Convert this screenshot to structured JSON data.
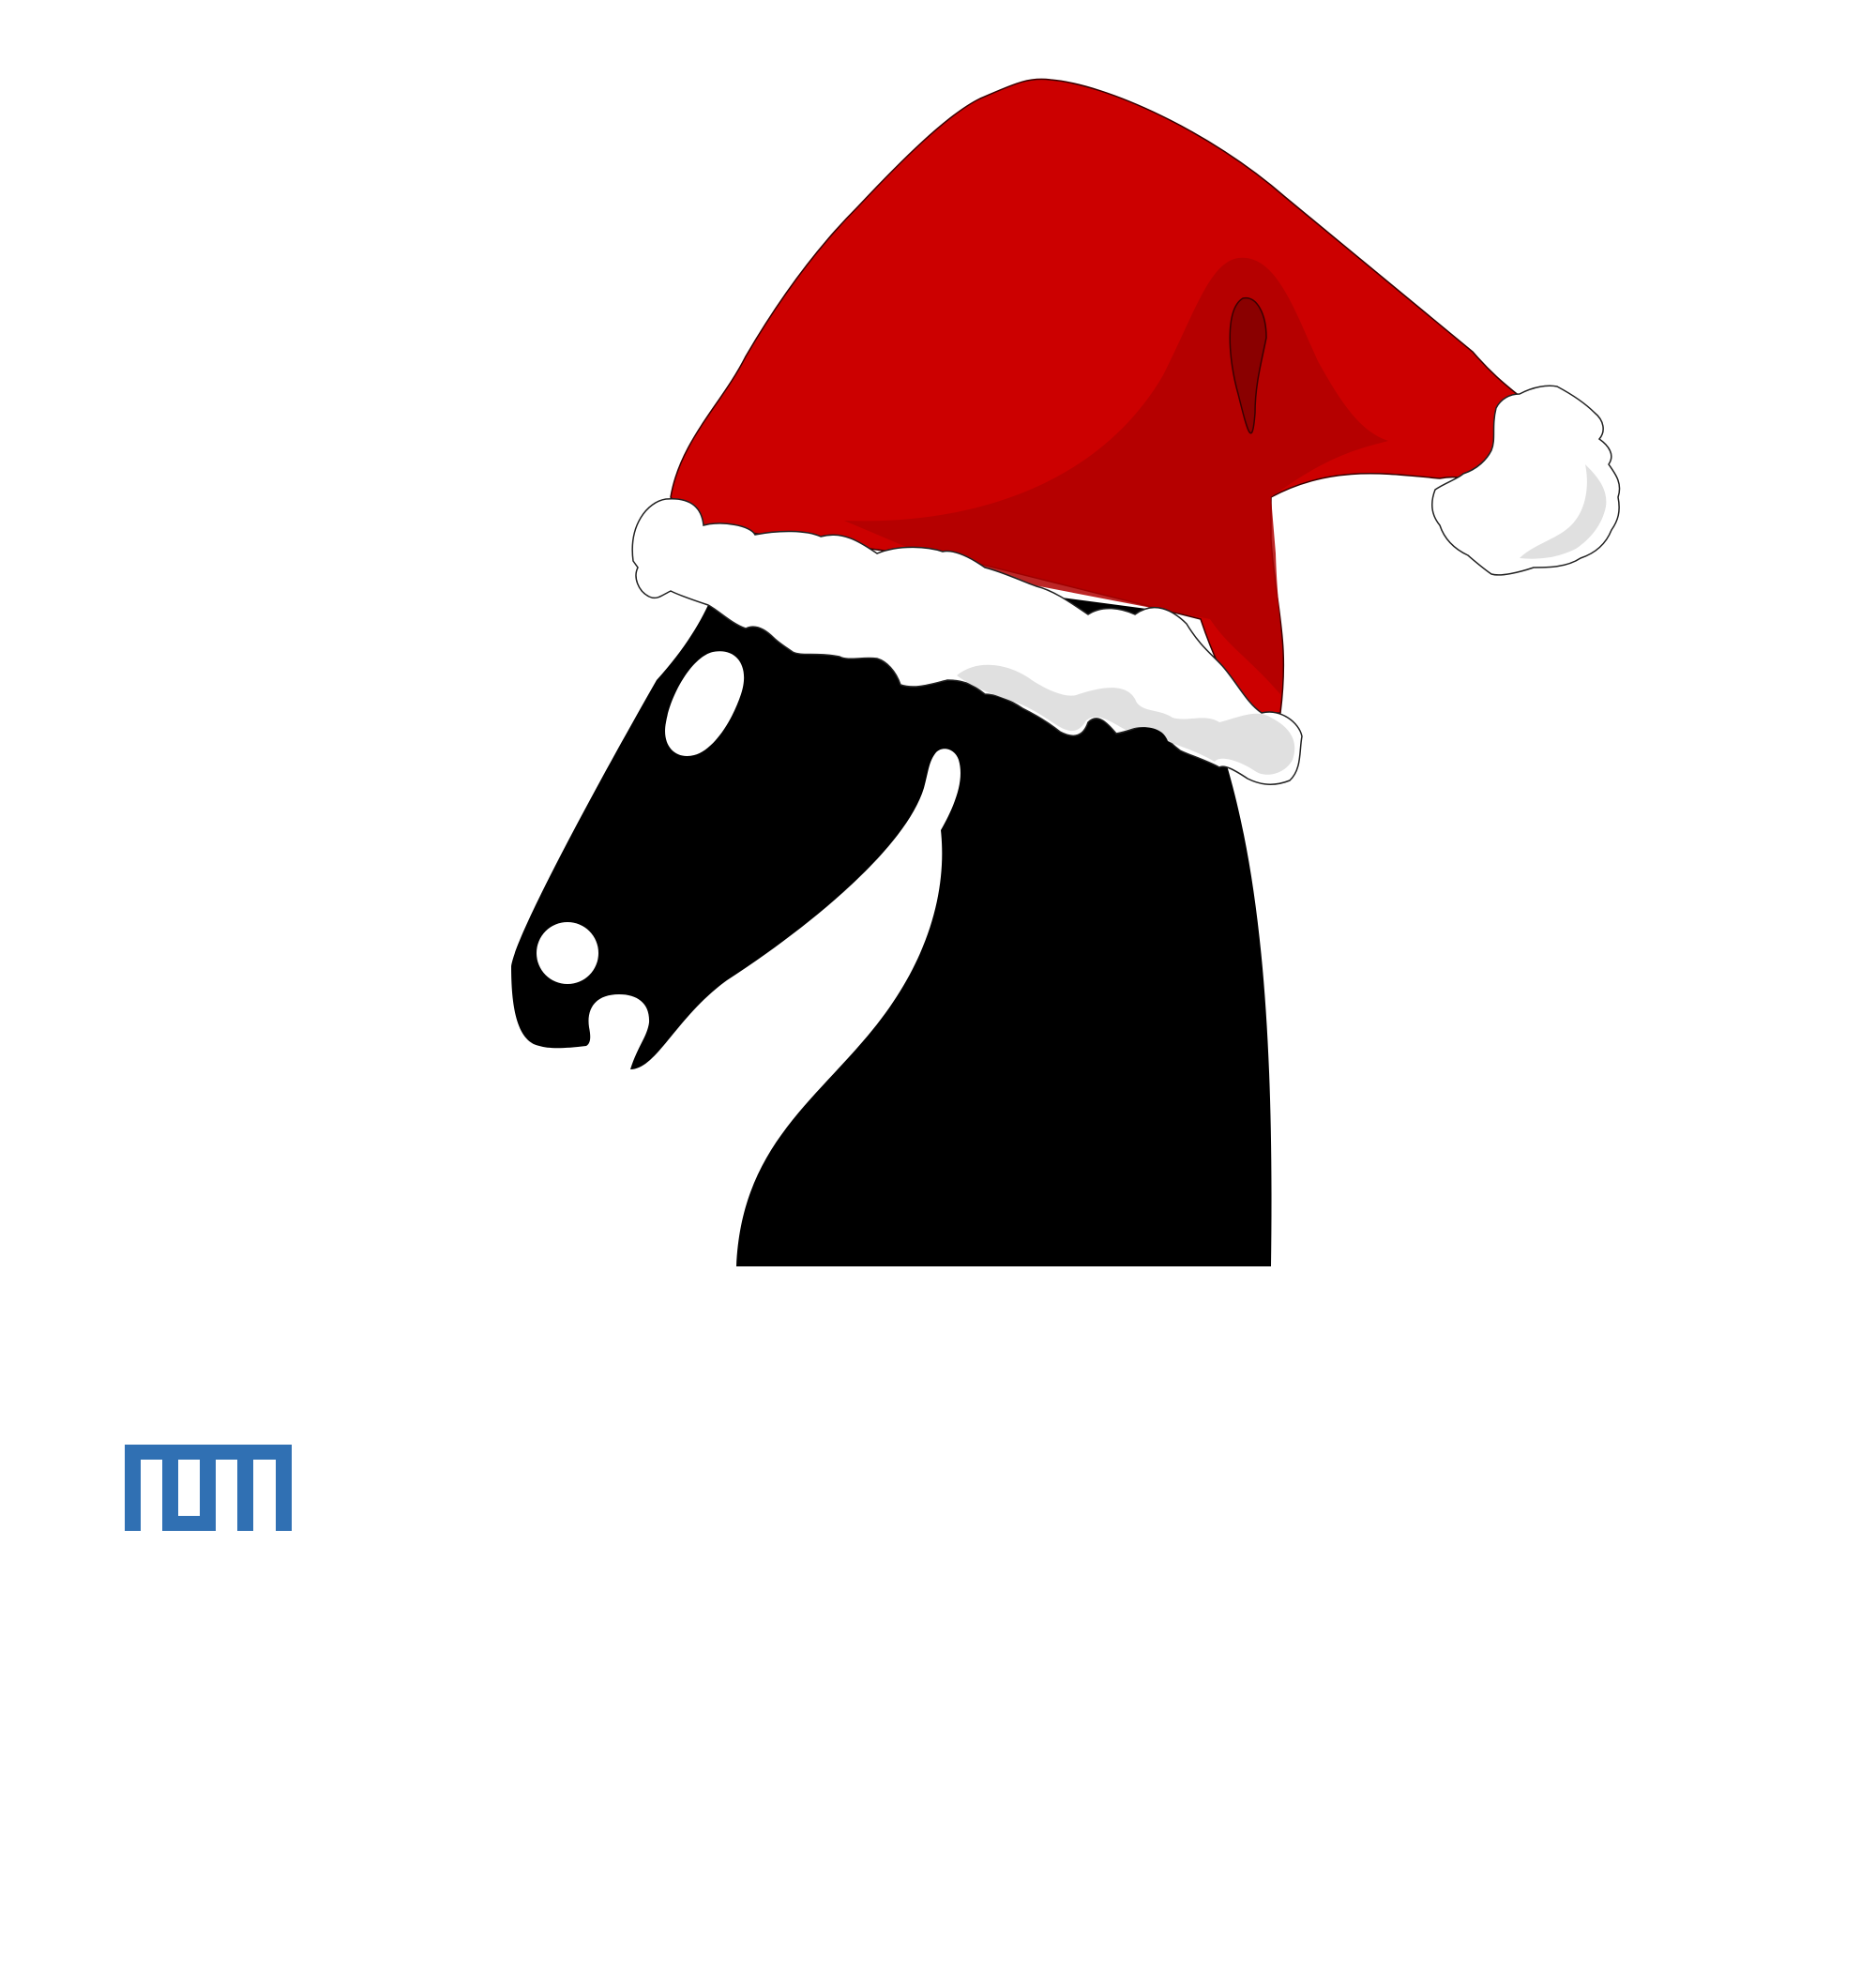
{
  "page": {
    "background": "#ffffff"
  },
  "knight_logo": {
    "icon": "chess-knight-icon",
    "head_color": "#000000",
    "hat": {
      "icon": "santa-hat-icon",
      "hat_color": "#cc0000",
      "hat_shadow_color": "#a80000",
      "fur_color": "#ffffff",
      "fur_shadow_color": "#e0e0e0"
    }
  },
  "tum_logo": {
    "icon": "tum-logo-icon",
    "wordmark": "TUM",
    "color": "#3070b3"
  }
}
